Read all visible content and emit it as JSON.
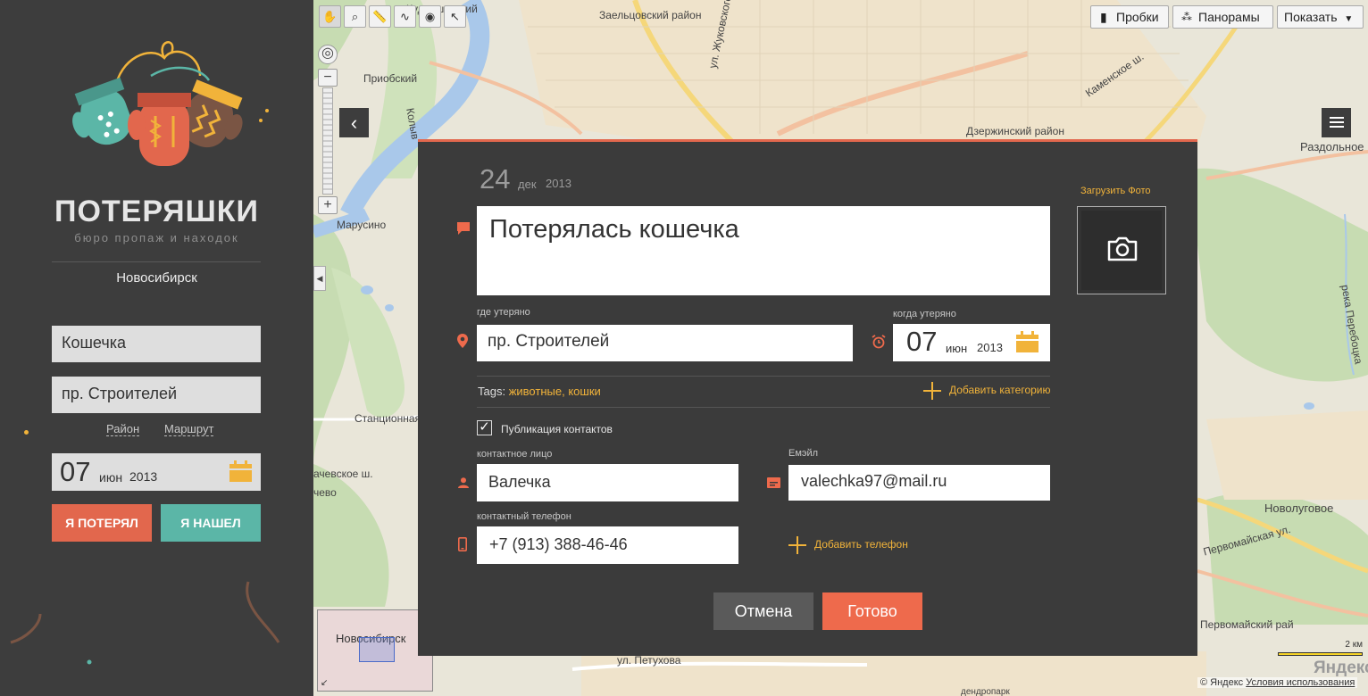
{
  "sidebar": {
    "brand_title": "ПОТЕРЯШКИ",
    "brand_subtitle": "бюро пропаж и находок",
    "city": "Новосибирск",
    "search_what": "Кошечка",
    "search_where": "пр. Строителей",
    "link_district": "Район",
    "link_route": "Маршрут",
    "date": {
      "day": "07",
      "month": "июн",
      "year": "2013"
    },
    "btn_lost": "Я ПОТЕРЯЛ",
    "btn_found": "Я НАШЕЛ",
    "colors": {
      "lost": "#e2674d",
      "found": "#5bb6a7",
      "bg": "#3d3d3d"
    }
  },
  "map": {
    "toolbar": [
      "hand-tool-icon",
      "magnifier-tool-icon",
      "ruler-tool-icon",
      "route-tool-icon",
      "balloon-tool-icon",
      "select-tool-icon"
    ],
    "traffic_label": "Пробки",
    "panorama_label": "Панорамы",
    "show_label": "Показать",
    "labels": {
      "zaeltsovsky": "Заельцовский район",
      "kudryashovsky": "Кудряшовский",
      "priobsky": "Приобский",
      "marusino": "Марусино",
      "zhukovskogo": "ул. Жуковского",
      "dzerzhinsky": "Дзержинский район",
      "razdolnoe": "Раздольное",
      "kamenskoe": "Каменское ш.",
      "pereboyka": "река Перебоцка",
      "stantsionnaya": "Станционная",
      "grachevskoe": "ачевское ш.",
      "chevo": "чево",
      "novolugovoe": "Новолуговое",
      "pervomaiskaya": "Первомайская ул.",
      "pervomaisky": "Первомайский рай",
      "petukhova": "ул. Петухова",
      "dendropark": "дендропарк",
      "kolyv": "Колыв"
    },
    "minimap_label": "Новосибирск",
    "scale": "2 км",
    "logo": "Яндекс",
    "copyright": "© Яндекс",
    "terms": "Условия использования"
  },
  "modal": {
    "created": {
      "day": "24",
      "month": "дек",
      "year": "2013"
    },
    "title_value": "Потерялась кошечка",
    "upload_photo": "Загрузить Фото",
    "where_label": "где утеряно",
    "where_value": "пр. Строителей",
    "when_label": "когда утеряно",
    "when": {
      "day": "07",
      "month": "июн",
      "year": "2013"
    },
    "tags_label": "Tags:",
    "tags": [
      "животные",
      "кошки"
    ],
    "add_category": "Добавить категорию",
    "publish_contacts": "Публикация контактов",
    "publish_checked": true,
    "person_label": "контактное лицо",
    "person_value": "Валечка",
    "email_label": "Емэйл",
    "email_value": "valechka97@mail.ru",
    "phone_label": "контактный телефон",
    "phone_value": "+7 (913) 388-46-46",
    "add_phone": "Добавить телефон",
    "cancel": "Отмена",
    "done": "Готово",
    "colors": {
      "accent": "#ee6a4c",
      "highlight": "#f1b33a",
      "bg": "#3b3b3b"
    }
  }
}
